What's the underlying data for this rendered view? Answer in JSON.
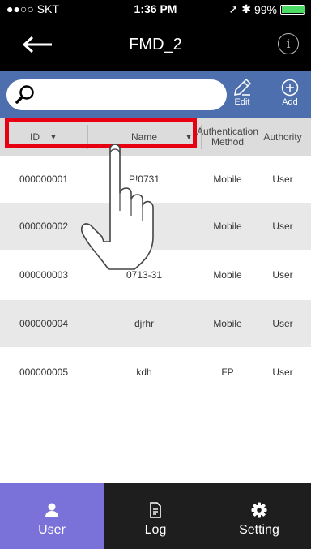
{
  "status": {
    "carrier": "●●○○ SKT",
    "time": "1:36 PM",
    "battery": "99%",
    "battery_level": 0.99
  },
  "nav": {
    "title": "FMD_2"
  },
  "toolbar": {
    "search_placeholder": "",
    "edit_label": "Edit",
    "add_label": "Add"
  },
  "table": {
    "headers": {
      "id": "ID",
      "name": "Name",
      "auth": "Authentication Method",
      "authority": "Authority"
    },
    "rows": [
      {
        "id": "000000001",
        "name": "P!0731",
        "auth": "Mobile",
        "authority": "User"
      },
      {
        "id": "000000002",
        "name": "",
        "auth": "Mobile",
        "authority": "User"
      },
      {
        "id": "000000003",
        "name": "0713-31",
        "auth": "Mobile",
        "authority": "User"
      },
      {
        "id": "000000004",
        "name": "djrhr",
        "auth": "Mobile",
        "authority": "User"
      },
      {
        "id": "000000005",
        "name": "kdh",
        "auth": "FP",
        "authority": "User"
      }
    ]
  },
  "tabs": {
    "user": "User",
    "log": "Log",
    "setting": "Setting"
  },
  "colors": {
    "accent": "#4d6fae",
    "active_tab": "#7a72d8",
    "highlight": "#e60012"
  }
}
